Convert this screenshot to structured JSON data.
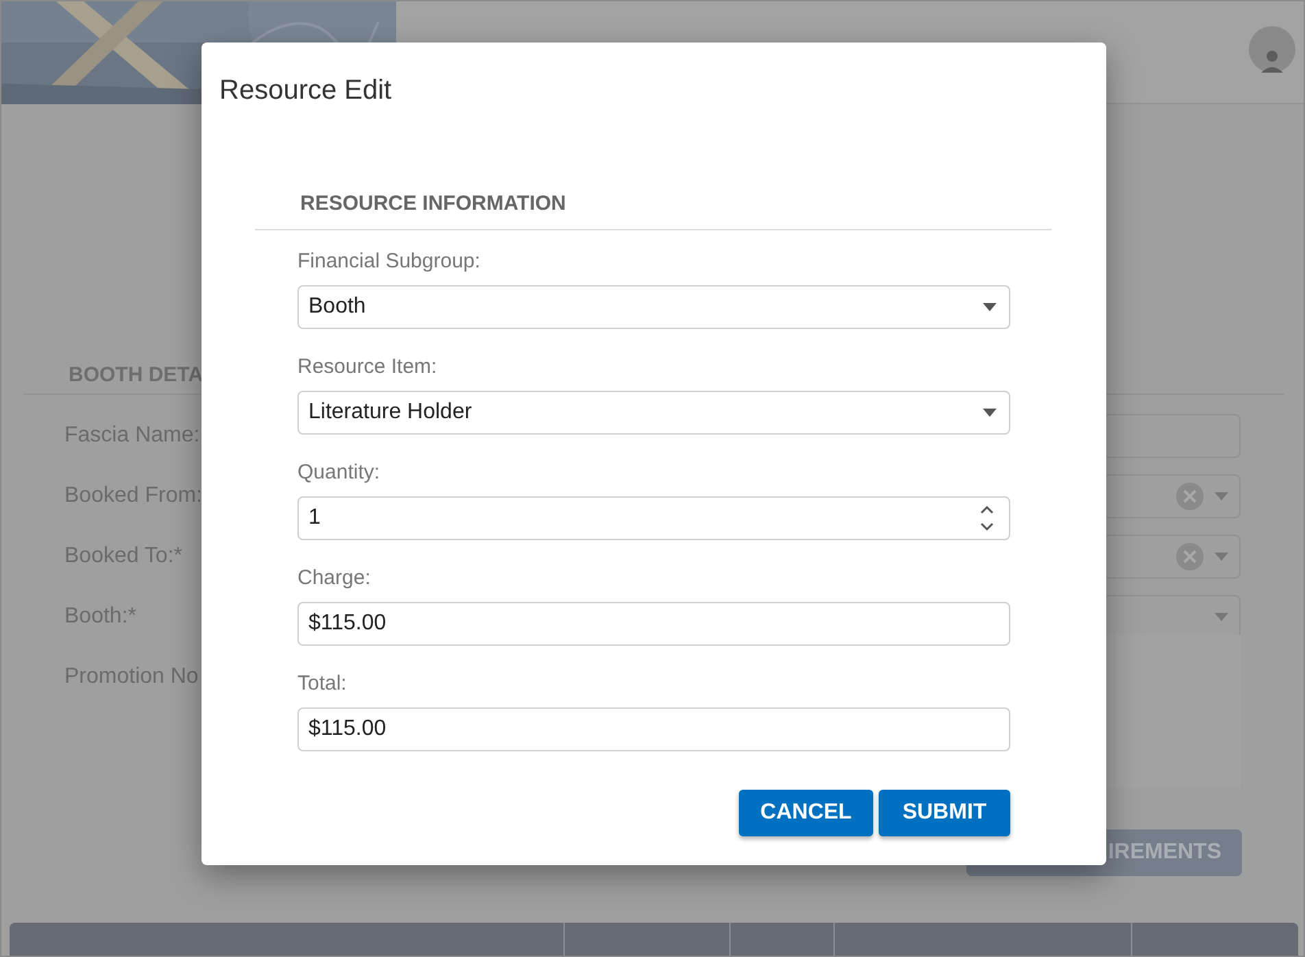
{
  "background": {
    "section_title": "BOOTH DETA",
    "rows": [
      {
        "label": "Fascia Name:",
        "kind": "text"
      },
      {
        "label": "Booked From:",
        "kind": "clearable_select"
      },
      {
        "label": "Booked To:*",
        "kind": "clearable_select"
      },
      {
        "label": "Booth:*",
        "kind": "select"
      },
      {
        "label": "Promotion No",
        "kind": "textarea"
      }
    ],
    "button": "IREMENTS"
  },
  "dialog": {
    "title": "Resource Edit",
    "section_title": "RESOURCE INFORMATION",
    "fields": [
      {
        "label": "Financial Subgroup:",
        "value": "Booth",
        "kind": "select"
      },
      {
        "label": "Resource Item:",
        "value": "Literature Holder",
        "kind": "select"
      },
      {
        "label": "Quantity:",
        "value": "1",
        "kind": "number"
      },
      {
        "label": "Charge:",
        "value": "$115.00",
        "kind": "text"
      },
      {
        "label": "Total:",
        "value": "$115.00",
        "kind": "text"
      }
    ],
    "buttons": [
      "CANCEL",
      "SUBMIT"
    ]
  }
}
